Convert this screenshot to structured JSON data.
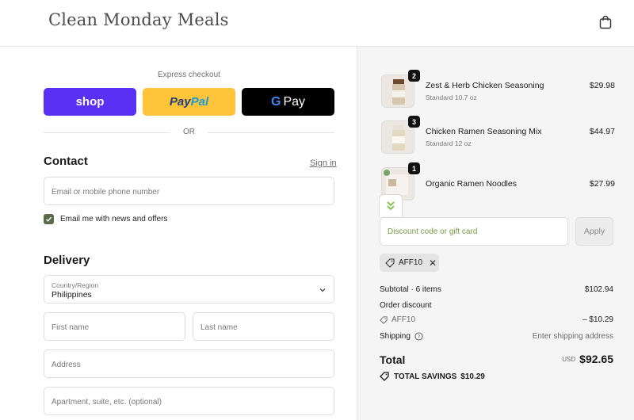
{
  "header": {
    "logo": "Clean Monday Meals",
    "cart_icon": "shopping-bag-icon"
  },
  "express": {
    "label": "Express checkout",
    "shop_label": "shop",
    "paypal_label_1": "Pay",
    "paypal_label_2": "Pal",
    "gpay_g": "G",
    "gpay_label": "Pay",
    "or_label": "OR",
    "colors": {
      "shop": "#5a31f4",
      "paypal": "#ffc439",
      "gpay": "#000000"
    }
  },
  "contact": {
    "title": "Contact",
    "sign_in": "Sign in",
    "email_placeholder": "Email or mobile phone number",
    "news_checkbox_label": "Email me with news and offers",
    "news_checked": true
  },
  "delivery": {
    "title": "Delivery",
    "country_label": "Country/Region",
    "country_value": "Philippines",
    "first_name_placeholder": "First name",
    "last_name_placeholder": "Last name",
    "address_placeholder": "Address",
    "apartment_placeholder": "Apartment, suite, etc. (optional)"
  },
  "order": {
    "items": [
      {
        "name": "Zest & Herb Chicken Seasoning",
        "variant": "Standard 10.7 oz",
        "quantity": "2",
        "price": "$29.98"
      },
      {
        "name": "Chicken Ramen Seasoning Mix",
        "variant": "Standard 12 oz",
        "quantity": "3",
        "price": "$44.97"
      },
      {
        "name": "Organic Ramen Noodles",
        "variant": "",
        "quantity": "1",
        "price": "$27.99"
      }
    ],
    "discount_placeholder": "Discount code or gift card",
    "apply_label": "Apply",
    "applied_code": "AFF10",
    "subtotal_label": "Subtotal · 6 items",
    "subtotal_value": "$102.94",
    "order_discount_label": "Order discount",
    "discount_code": "AFF10",
    "discount_value": "– $10.29",
    "shipping_label": "Shipping",
    "shipping_value": "Enter shipping address",
    "total_label": "Total",
    "currency": "USD",
    "total_value": "$92.65",
    "savings_label": "TOTAL SAVINGS",
    "savings_value": "$10.29"
  }
}
